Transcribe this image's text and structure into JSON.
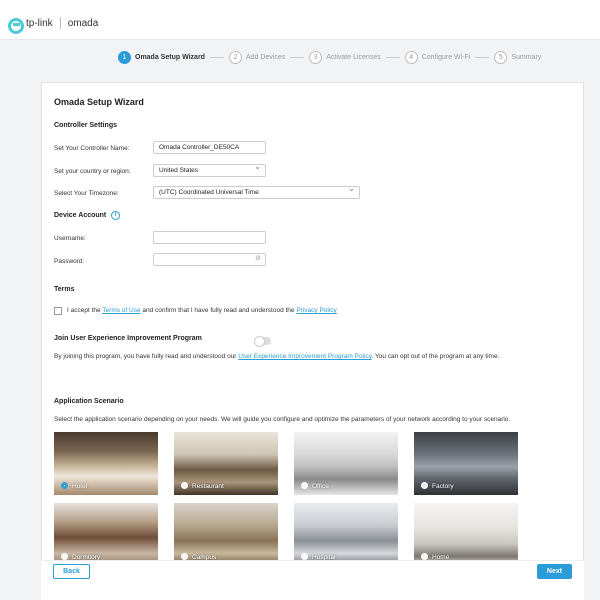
{
  "brand": {
    "tplink": "tp-link",
    "omada": "omada",
    "accent": "#2a9cd8"
  },
  "steps": [
    {
      "num": "1",
      "label": "Omada Setup Wizard",
      "active": true
    },
    {
      "num": "2",
      "label": "Add Devices",
      "active": false
    },
    {
      "num": "3",
      "label": "Activate Licenses",
      "active": false
    },
    {
      "num": "4",
      "label": "Configure Wi-Fi",
      "active": false
    },
    {
      "num": "5",
      "label": "Summary",
      "active": false
    }
  ],
  "wizard": {
    "title": "Omada Setup Wizard",
    "controller_settings": {
      "title": "Controller Settings",
      "name_label": "Set Your Controller Name:",
      "name_value": "Omada Controller_DE50CA",
      "country_label": "Set your country or region:",
      "country_value": "United States",
      "timezone_label": "Select Your Timezone:",
      "timezone_value": "(UTC) Coordinated Universal Time"
    },
    "device_account": {
      "title": "Device Account",
      "info_icon": "info-icon",
      "username_label": "Username:",
      "username_value": "",
      "password_label": "Password:",
      "password_value": "",
      "eye_icon": "eye-off-icon"
    },
    "terms": {
      "title": "Terms",
      "text_1": "I accept the ",
      "link_1": "Terms of Use",
      "text_2": " and confirm that I have fully read and understood the ",
      "link_2": "Privacy Policy",
      "checked": false
    },
    "join": {
      "title": "Join User Experience Improvement Program",
      "enabled": false,
      "text_1": "By joining this program, you have fully read and understood our ",
      "link": "User Experience Improvement Program Policy",
      "text_2": ". You can opt out of the program at any time."
    },
    "scenario": {
      "title": "Application Scenario",
      "desc": "Select the application scenario depending on your needs. We will guide you configure and optimize the parameters of your network according to your scenario.",
      "tiles": [
        {
          "label": "Hotel",
          "selected": true
        },
        {
          "label": "Restaurant",
          "selected": false
        },
        {
          "label": "Office",
          "selected": false
        },
        {
          "label": "Factory",
          "selected": false
        },
        {
          "label": "Dormitory",
          "selected": false
        },
        {
          "label": "Campus",
          "selected": false
        },
        {
          "label": "Hospital",
          "selected": false
        },
        {
          "label": "Home",
          "selected": false
        }
      ]
    }
  },
  "footer": {
    "back": "Back",
    "next": "Next"
  }
}
